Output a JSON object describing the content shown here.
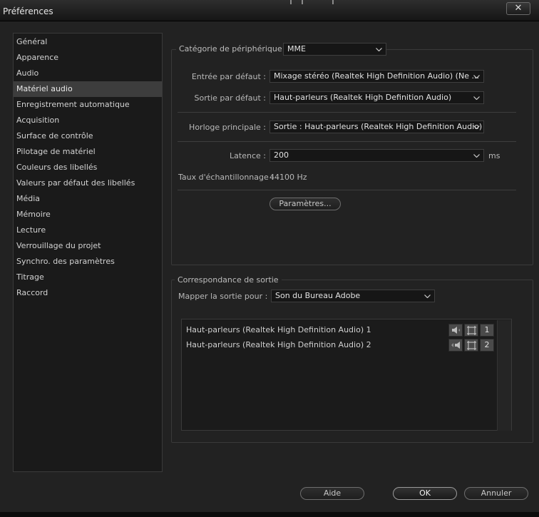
{
  "window": {
    "title": "Préférences",
    "close_glyph": "✕"
  },
  "sidebar": {
    "items": [
      {
        "label": "Général"
      },
      {
        "label": "Apparence"
      },
      {
        "label": "Audio"
      },
      {
        "label": "Matériel audio",
        "active": true
      },
      {
        "label": "Enregistrement automatique"
      },
      {
        "label": "Acquisition"
      },
      {
        "label": "Surface de contrôle"
      },
      {
        "label": "Pilotage de matériel"
      },
      {
        "label": "Couleurs des libellés"
      },
      {
        "label": "Valeurs par défaut des libellés"
      },
      {
        "label": "Média"
      },
      {
        "label": "Mémoire"
      },
      {
        "label": "Lecture"
      },
      {
        "label": "Verrouillage du projet"
      },
      {
        "label": "Synchro. des paramètres"
      },
      {
        "label": "Titrage"
      },
      {
        "label": "Raccord"
      }
    ]
  },
  "device": {
    "category_label": "Catégorie de périphérique :",
    "category_value": "MME",
    "input_label": "Entrée par défaut :",
    "input_value": "Mixage stéréo (Realtek High Definition Audio) (Ne ...",
    "output_label": "Sortie par défaut :",
    "output_value": "Haut-parleurs (Realtek High Definition Audio)",
    "clock_label": "Horloge principale :",
    "clock_value": "Sortie : Haut-parleurs (Realtek High Definition Audio)",
    "latency_label": "Latence :",
    "latency_value": "200",
    "latency_unit": "ms",
    "sample_rate_label": "Taux d'échantillonnage :",
    "sample_rate_value": "44100 Hz",
    "settings_button": "Paramètres..."
  },
  "output_mapping": {
    "legend": "Correspondance de sortie",
    "map_label": "Mapper la sortie pour :",
    "map_value": "Son du Bureau Adobe",
    "rows": [
      {
        "label": "Haut-parleurs (Realtek High Definition Audio) 1",
        "channel": "1",
        "icon": "speaker-left-icon"
      },
      {
        "label": "Haut-parleurs (Realtek High Definition Audio) 2",
        "channel": "2",
        "icon": "speaker-right-icon"
      }
    ]
  },
  "footer": {
    "help": "Aide",
    "ok": "OK",
    "cancel": "Annuler"
  }
}
